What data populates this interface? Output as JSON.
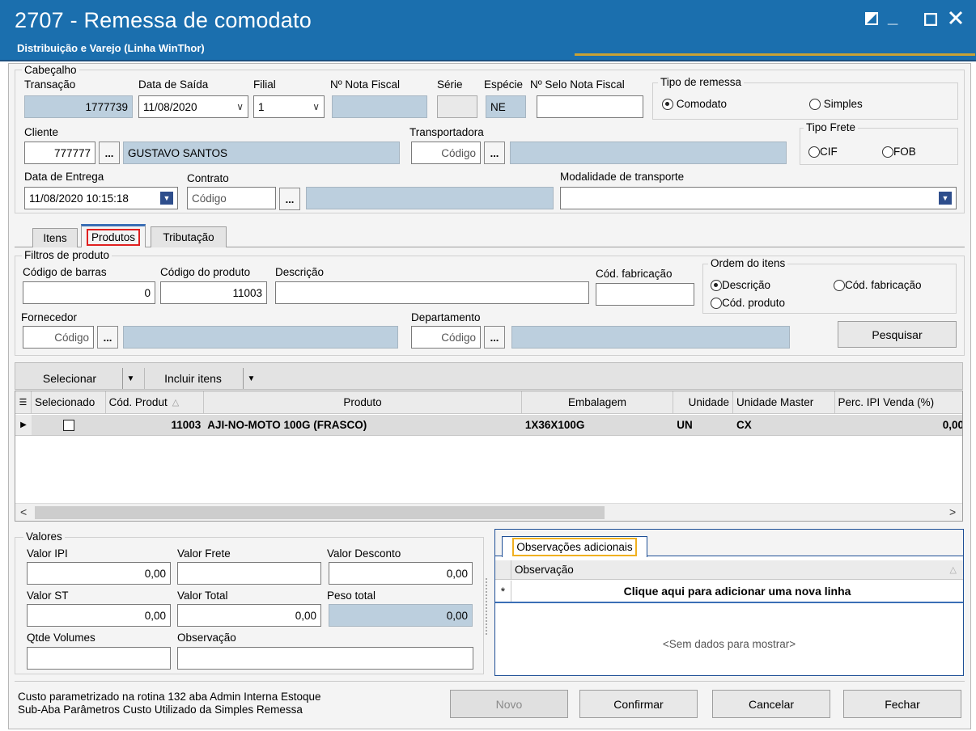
{
  "window": {
    "title": "2707 - Remessa de comodato",
    "subtitle": "Distribuição e Varejo (Linha WinThor)",
    "icons": {
      "restore": "restore-icon",
      "minimize": "minimize-icon",
      "maximize": "maximize-icon",
      "close": "close-icon"
    }
  },
  "cabecalho": {
    "legend": "Cabeçalho",
    "transacao": {
      "label": "Transação",
      "value": "1777739"
    },
    "data_saida": {
      "label": "Data de Saída",
      "value": "11/08/2020"
    },
    "filial": {
      "label": "Filial",
      "value": "1"
    },
    "nota_fiscal": {
      "label": "Nº Nota Fiscal",
      "value": ""
    },
    "serie": {
      "label": "Série",
      "value": ""
    },
    "especie": {
      "label": "Espécie",
      "value": "NE"
    },
    "selo": {
      "label": "Nº Selo Nota Fiscal",
      "value": ""
    },
    "tipo_remessa": {
      "legend": "Tipo de remessa",
      "options": [
        "Comodato",
        "Simples"
      ],
      "selected": "Comodato"
    },
    "cliente": {
      "label": "Cliente",
      "code": "777777",
      "name": "GUSTAVO SANTOS"
    },
    "transportadora": {
      "label": "Transportadora",
      "placeholder": "Código",
      "name": ""
    },
    "tipo_frete": {
      "legend": "Tipo Frete",
      "options": [
        "CIF",
        "FOB"
      ],
      "selected": ""
    },
    "data_entrega": {
      "label": "Data de Entrega",
      "value": "11/08/2020 10:15:18"
    },
    "contrato": {
      "label": "Contrato",
      "placeholder": "Código"
    },
    "modalidade": {
      "label": "Modalidade de transporte",
      "value": ""
    }
  },
  "tabs": [
    {
      "label": "Itens"
    },
    {
      "label": "Produtos"
    },
    {
      "label": "Tributação"
    }
  ],
  "filtros": {
    "legend": "Filtros de produto",
    "codigo_barras": {
      "label": "Código de barras",
      "value": "0"
    },
    "codigo_produto": {
      "label": "Código do produto",
      "value": "11003"
    },
    "descricao": {
      "label": "Descrição",
      "value": ""
    },
    "cod_fabricacao": {
      "label": "Cód. fabricação",
      "value": ""
    },
    "ordem": {
      "legend": "Ordem do itens",
      "options": [
        "Descrição",
        "Cód. fabricação",
        "Cód. produto"
      ],
      "selected": "Descrição"
    },
    "fornecedor": {
      "label": "Fornecedor",
      "placeholder": "Código"
    },
    "departamento": {
      "label": "Departamento",
      "placeholder": "Código"
    },
    "pesquisar": "Pesquisar"
  },
  "toolbar": {
    "selecionar": "Selecionar",
    "incluir": "Incluir itens"
  },
  "grid": {
    "columns": [
      "Selecionado",
      "Cód. Produt",
      "Produto",
      "Embalagem",
      "Unidade",
      "Unidade Master",
      "Perc. IPI Venda (%)"
    ],
    "rows": [
      {
        "selecionado": false,
        "cod": "11003",
        "produto": "AJI-NO-MOTO 100G (FRASCO)",
        "embalagem": "1X36X100G",
        "unidade": "UN",
        "unidade_master": "CX",
        "perc_ipi": "0,00"
      }
    ]
  },
  "valores": {
    "legend": "Valores",
    "ipi": {
      "label": "Valor IPI",
      "value": "0,00"
    },
    "frete": {
      "label": "Valor Frete",
      "value": ""
    },
    "desconto": {
      "label": "Valor Desconto",
      "value": "0,00"
    },
    "st": {
      "label": "Valor ST",
      "value": "0,00"
    },
    "total": {
      "label": "Valor Total",
      "value": "0,00"
    },
    "peso": {
      "label": "Peso total",
      "value": "0,00"
    },
    "volumes": {
      "label": "Qtde Volumes",
      "value": ""
    },
    "observacao": {
      "label": "Observação",
      "value": ""
    }
  },
  "observacoes": {
    "tab": "Observações adicionais",
    "column": "Observação",
    "new_row": "Clique aqui para adicionar uma nova linha",
    "empty": "<Sem dados para mostrar>"
  },
  "footer": {
    "note_line1": "Custo parametrizado na rotina 132 aba Admin Interna  Estoque",
    "note_line2": "Sub-Aba Parâmetros Custo Utilizado da Simples Remessa",
    "novo": "Novo",
    "confirmar": "Confirmar",
    "cancelar": "Cancelar",
    "fechar": "Fechar"
  },
  "colors": {
    "titlebar": "#1b6fae",
    "disabled_field": "#bccfde",
    "grid_header": "#ebebeb",
    "highlight_box": "#e02020"
  }
}
